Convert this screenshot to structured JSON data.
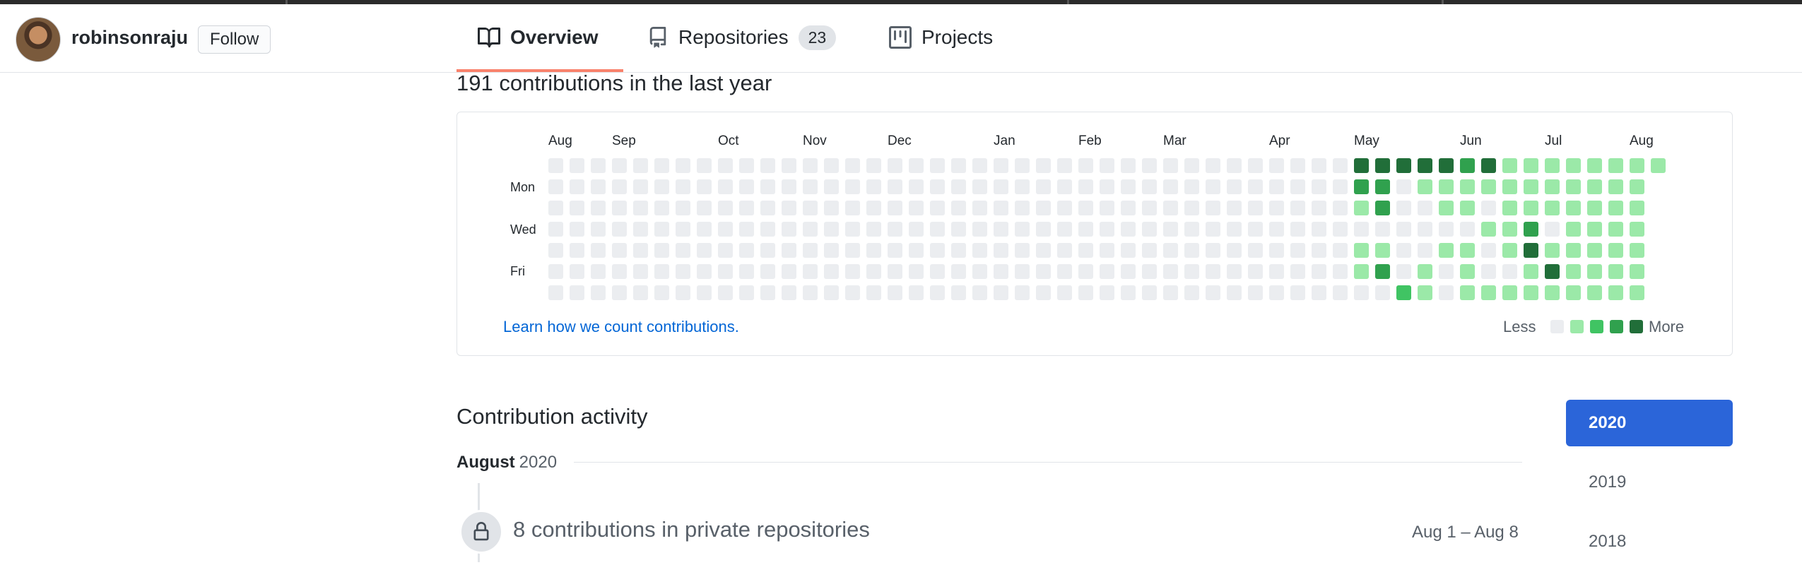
{
  "header": {
    "username": "robinsonraju",
    "follow_label": "Follow",
    "tabs": [
      {
        "label": "Overview",
        "icon": "book-icon",
        "active": true
      },
      {
        "label": "Repositories",
        "icon": "repo-icon",
        "count": "23"
      },
      {
        "label": "Projects",
        "icon": "project-icon"
      }
    ]
  },
  "contributions": {
    "title": "191 contributions in the last year",
    "learn_link": "Learn how we count contributions.",
    "legend_less": "Less",
    "legend_more": "More",
    "level_colors": [
      "#ebedf0",
      "#9be9a8",
      "#40c463",
      "#30a14e",
      "#216e39"
    ],
    "day_labels": [
      "Mon",
      "Wed",
      "Fri"
    ],
    "months": [
      {
        "label": "Aug",
        "week": 0
      },
      {
        "label": "Sep",
        "week": 3
      },
      {
        "label": "Oct",
        "week": 8
      },
      {
        "label": "Nov",
        "week": 12
      },
      {
        "label": "Dec",
        "week": 16
      },
      {
        "label": "Jan",
        "week": 21
      },
      {
        "label": "Feb",
        "week": 25
      },
      {
        "label": "Mar",
        "week": 29
      },
      {
        "label": "Apr",
        "week": 34
      },
      {
        "label": "May",
        "week": 38
      },
      {
        "label": "Jun",
        "week": 43
      },
      {
        "label": "Jul",
        "week": 47
      },
      {
        "label": "Aug",
        "week": 51
      }
    ],
    "weeks": 53,
    "last_week_days": 1,
    "grid_by_day": [
      "00000000000000000000000000000000000000444443411111111",
      "00000000000000000000000000000000000000330111111111111",
      "00000000000000000000000000000000000000130011011111111",
      "00000000000000000000000000000000000000000000113011111",
      "00000000000000000000000000000000000000110011014111111",
      "00000000000000000000000000000000000000130101001411111",
      "00000000000000000000000000000000000000002101111111111"
    ]
  },
  "activity": {
    "title": "Contribution activity",
    "month": "August",
    "year": "2020",
    "item_text": "8 contributions in private repositories",
    "item_date": "Aug 1 – Aug 8"
  },
  "years": [
    "2020",
    "2019",
    "2018"
  ]
}
